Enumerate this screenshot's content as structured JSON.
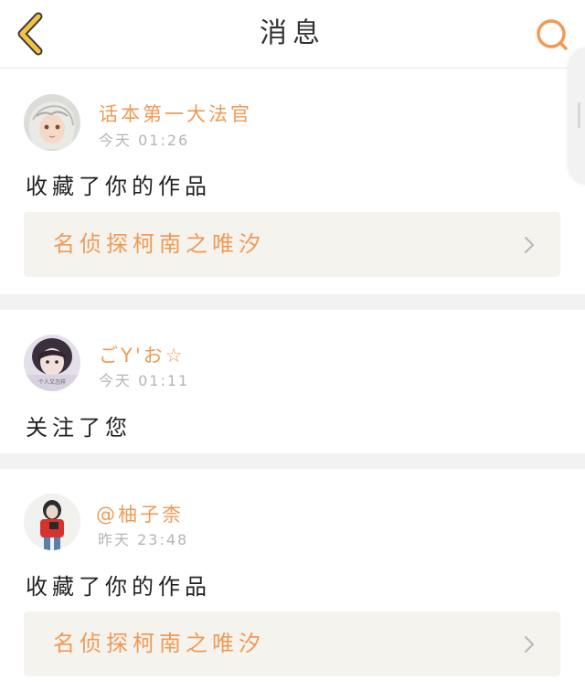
{
  "header": {
    "title": "消息",
    "back_icon": "chevron-left-icon",
    "search_icon": "search-icon",
    "accent_color": "#f5b731"
  },
  "messages": [
    {
      "username": "话本第一大法官",
      "time": "今天 01:26",
      "action": "收藏了你的作品",
      "work_title": "名侦探柯南之唯汐"
    },
    {
      "username": "ごY'お☆",
      "time": "今天 01:11",
      "action": "关注了您",
      "avatar_caption": "个人又怎样"
    },
    {
      "username": "@柚子柰",
      "time": "昨天 23:48",
      "action": "收藏了你的作品",
      "work_title": "名侦探柯南之唯汐"
    }
  ],
  "colors": {
    "username": "#f09a55",
    "timestamp": "#b5b5b5",
    "separator": "#f2f2f2",
    "work_box": "#f4f3ee"
  }
}
